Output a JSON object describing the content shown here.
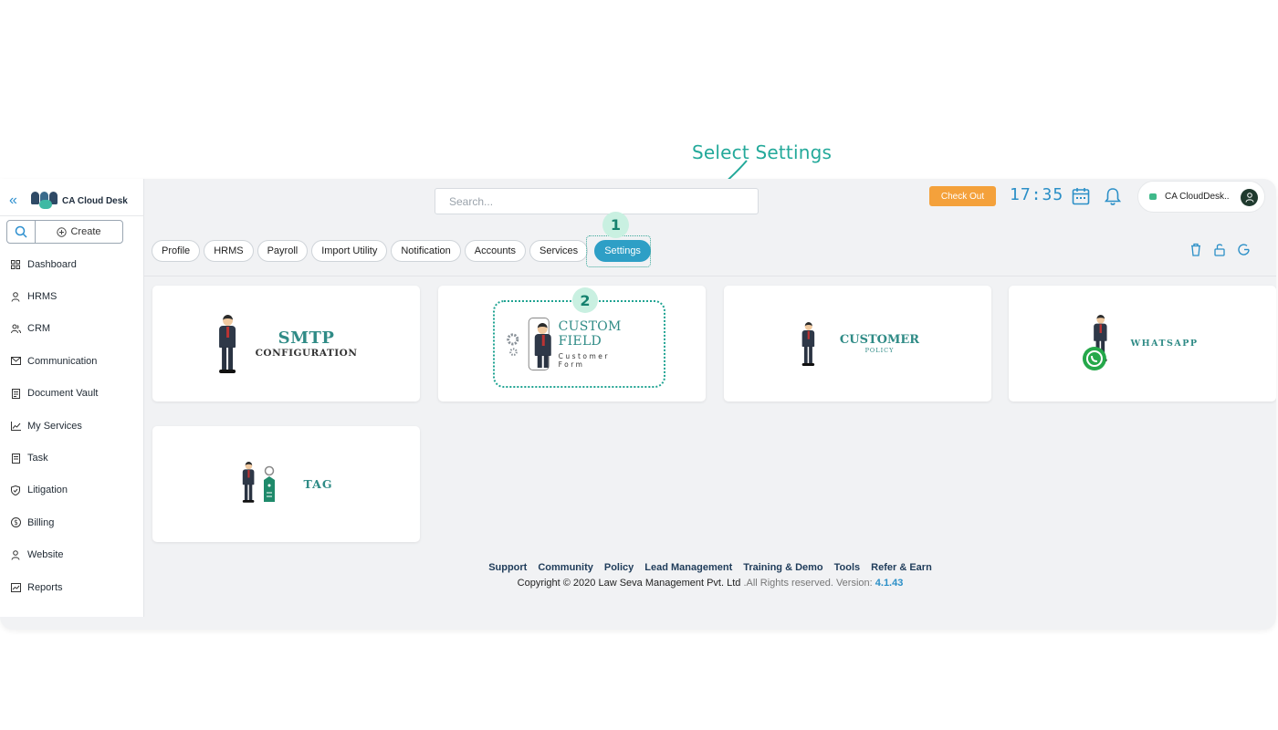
{
  "annotation": {
    "caption": "Select Settings",
    "step1": "1",
    "step2": "2"
  },
  "brand": {
    "title": "CA Cloud Desk"
  },
  "sidebar": {
    "create_label": "Create",
    "items": [
      {
        "label": "Dashboard",
        "icon": "grid-icon"
      },
      {
        "label": "HRMS",
        "icon": "user-icon"
      },
      {
        "label": "CRM",
        "icon": "users-icon"
      },
      {
        "label": "Communication",
        "icon": "mail-icon"
      },
      {
        "label": "Document Vault",
        "icon": "document-icon"
      },
      {
        "label": "My Services",
        "icon": "chart-icon"
      },
      {
        "label": "Task",
        "icon": "task-icon"
      },
      {
        "label": "Litigation",
        "icon": "shield-icon"
      },
      {
        "label": "Billing",
        "icon": "dollar-icon"
      },
      {
        "label": "Website",
        "icon": "user-icon"
      },
      {
        "label": "Reports",
        "icon": "report-icon"
      }
    ]
  },
  "topbar": {
    "search_placeholder": "Search...",
    "checkout_label": "Check Out",
    "time": "17:35",
    "profile_name": "CA CloudDesk.."
  },
  "tabs": [
    {
      "label": "Profile",
      "active": false
    },
    {
      "label": "HRMS",
      "active": false
    },
    {
      "label": "Payroll",
      "active": false
    },
    {
      "label": "Import Utility",
      "active": false
    },
    {
      "label": "Notification",
      "active": false
    },
    {
      "label": "Accounts",
      "active": false
    },
    {
      "label": "Services",
      "active": false
    },
    {
      "label": "Settings",
      "active": true
    }
  ],
  "cards": {
    "smtp": {
      "title": "SMTP",
      "subtitle": "CONFIGURATION"
    },
    "custom_field": {
      "title": "CUSTOM FIELD",
      "subtitle": "Customer Form"
    },
    "customer_policy": {
      "title": "CUSTOMER",
      "subtitle": "POLICY"
    },
    "whatsapp": {
      "title": "WHATSAPP"
    },
    "tag": {
      "title": "TAG"
    }
  },
  "footer": {
    "links": [
      "Support",
      "Community",
      "Policy",
      "Lead Management",
      "Training & Demo",
      "Tools",
      "Refer & Earn"
    ],
    "copyright": "Copyright © 2020 Law Seva Management Pvt. Ltd",
    "rights": ".All Rights reserved.",
    "version_label": "Version:",
    "version": "4.1.43"
  },
  "colors": {
    "accent": "#2e9fc6",
    "annotation": "#23a99a",
    "checkout": "#f4a13b"
  }
}
